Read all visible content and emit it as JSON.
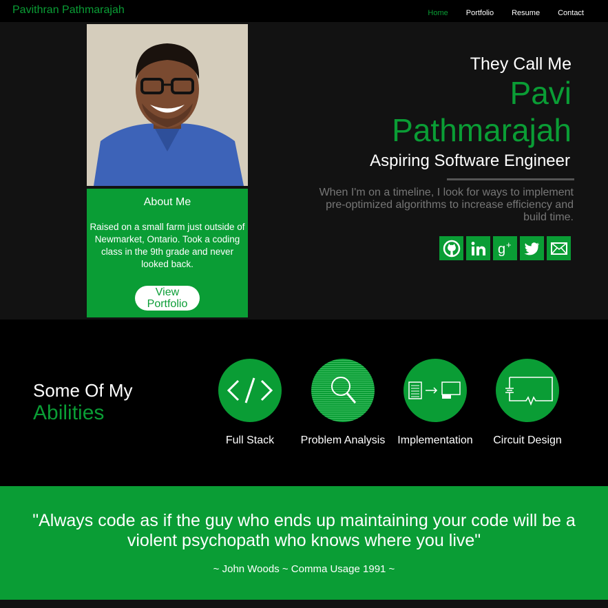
{
  "brand": "Pavithran Pathmarajah",
  "nav": [
    {
      "label": "Home",
      "active": true
    },
    {
      "label": "Portfolio",
      "active": false
    },
    {
      "label": "Resume",
      "active": false
    },
    {
      "label": "Contact",
      "active": false
    }
  ],
  "hero": {
    "call_me": "They Call Me",
    "first_name": "Pavi",
    "last_name": "Pathmarajah",
    "tagline": "Aspiring Software Engineer",
    "blurb": "When I'm on a timeline, I look for ways to implement pre-optimized algorithms to increase efficiency and build time.",
    "socials": [
      "github-icon",
      "linkedin-icon",
      "google-plus-icon",
      "twitter-icon",
      "email-icon"
    ]
  },
  "about": {
    "title": "About Me",
    "text": "Raised on a small farm just outside of Newmarket, Ontario. Took a coding class in the 9th grade and never looked back.",
    "button": "View Portfolio"
  },
  "abilities": {
    "title_line1": "Some Of My",
    "title_line2": "Abilities",
    "items": [
      {
        "label": "Full Stack",
        "icon": "code-icon"
      },
      {
        "label": "Problem Analysis",
        "icon": "magnifier-icon"
      },
      {
        "label": "Implementation",
        "icon": "implementation-icon"
      },
      {
        "label": "Circuit Design",
        "icon": "circuit-icon"
      }
    ]
  },
  "quote": {
    "text": "\"Always code as if the guy who ends up maintaining your code will be a violent psychopath who knows where you live\"",
    "author": "~ John Woods ~ Comma Usage 1991 ~"
  },
  "colors": {
    "accent": "#0a9d35",
    "background": "#000000",
    "panel": "#121212"
  }
}
